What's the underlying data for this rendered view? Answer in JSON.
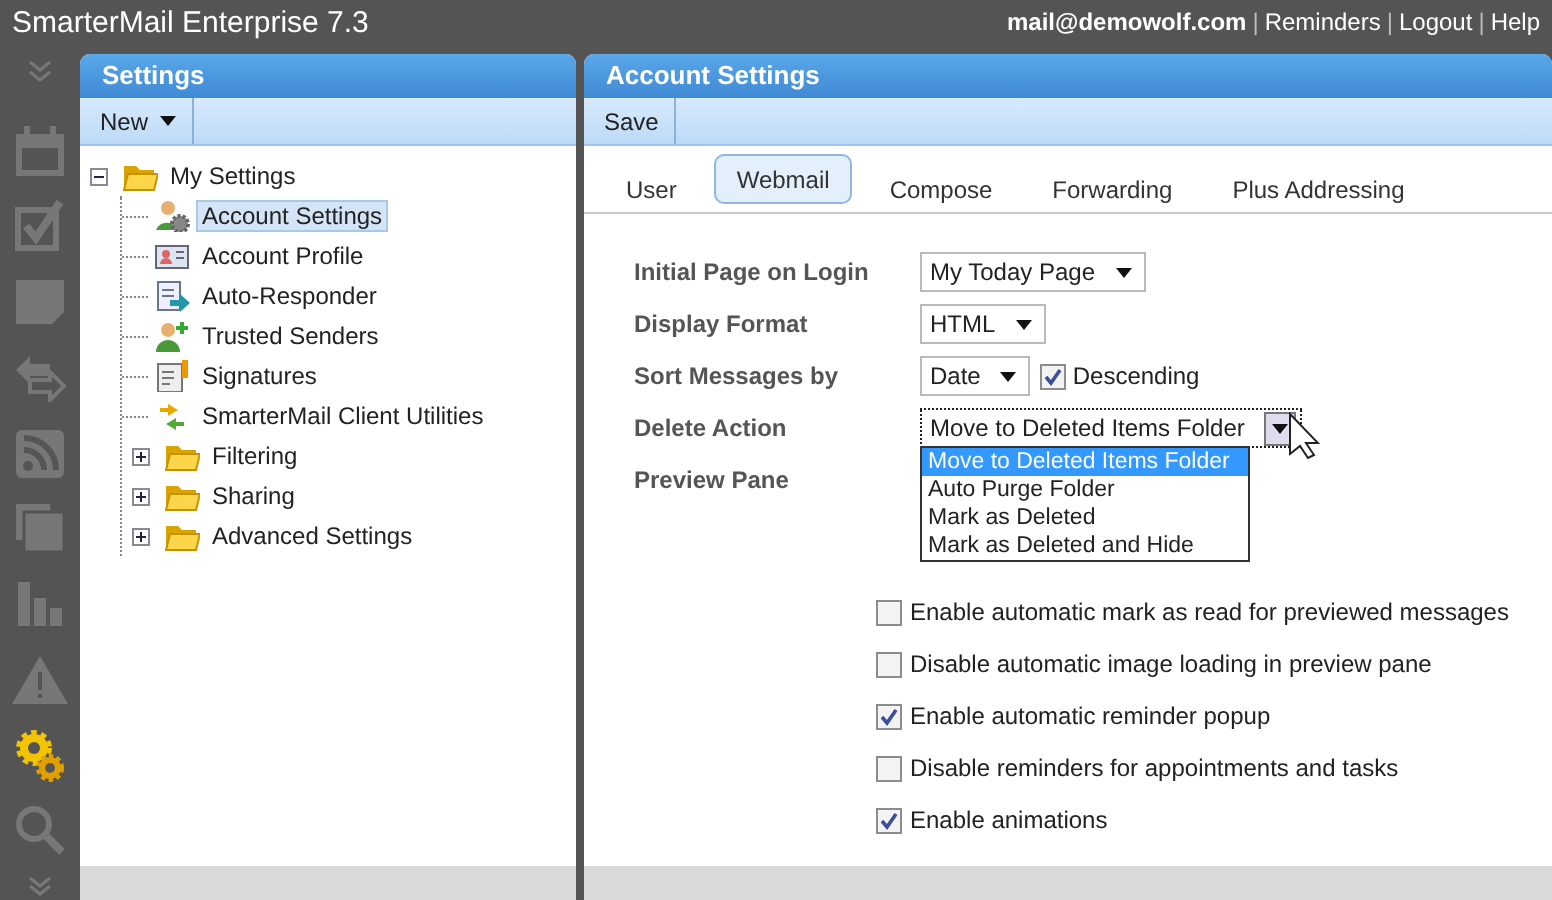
{
  "app_title": "SmarterMail Enterprise 7.3",
  "header": [
    {
      "kind": "user",
      "text": "mail@demowolf.com"
    },
    {
      "kind": "separator",
      "text": "|"
    },
    {
      "kind": "link",
      "text": "Reminders"
    },
    {
      "kind": "separator",
      "text": "|"
    },
    {
      "kind": "link",
      "text": "Logout"
    },
    {
      "kind": "separator",
      "text": "|"
    },
    {
      "kind": "link",
      "text": "Help"
    }
  ],
  "rail": [
    {
      "kind": "collapse",
      "selected": false
    },
    {
      "kind": "calendar",
      "selected": false
    },
    {
      "kind": "tasks",
      "selected": false
    },
    {
      "kind": "notes",
      "selected": false
    },
    {
      "kind": "sync",
      "selected": false
    },
    {
      "kind": "rss",
      "selected": false
    },
    {
      "kind": "files",
      "selected": false
    },
    {
      "kind": "reports",
      "selected": false
    },
    {
      "kind": "alerts",
      "selected": false
    },
    {
      "kind": "settings",
      "selected": true
    },
    {
      "kind": "search",
      "selected": false
    },
    {
      "kind": "expand",
      "selected": false
    }
  ],
  "settings_panel": {
    "title": "Settings",
    "toolbar": [
      {
        "label": "New",
        "dropdown": true
      }
    ],
    "tree": [
      {
        "label": "My Settings",
        "kind": "folder",
        "expanded": true,
        "selected": false,
        "children": [
          {
            "label": "Account Settings",
            "kind": "account",
            "selected": true
          },
          {
            "label": "Account Profile",
            "kind": "profile",
            "selected": false
          },
          {
            "label": "Auto-Responder",
            "kind": "responder",
            "selected": false
          },
          {
            "label": "Trusted Senders",
            "kind": "trusted",
            "selected": false
          },
          {
            "label": "Signatures",
            "kind": "signature",
            "selected": false
          },
          {
            "label": "SmarterMail Client Utilities",
            "kind": "utilities",
            "selected": false
          },
          {
            "label": "Filtering",
            "kind": "folder",
            "expanded": false,
            "selected": false
          },
          {
            "label": "Sharing",
            "kind": "folder",
            "expanded": false,
            "selected": false
          },
          {
            "label": "Advanced Settings",
            "kind": "folder",
            "expanded": false,
            "selected": false
          }
        ]
      }
    ]
  },
  "account_panel": {
    "title": "Account Settings",
    "toolbar": [
      {
        "label": "Save",
        "dropdown": false
      }
    ],
    "tabs": [
      {
        "label": "User",
        "selected": false
      },
      {
        "label": "Webmail",
        "selected": true
      },
      {
        "label": "Compose",
        "selected": false
      },
      {
        "label": "Forwarding",
        "selected": false
      },
      {
        "label": "Plus Addressing",
        "selected": false
      }
    ],
    "fields": [
      {
        "label": "Initial Page on Login",
        "value": "My Today Page"
      },
      {
        "label": "Display Format",
        "value": "HTML"
      },
      {
        "label": "Sort Messages by",
        "value": "Date",
        "checkbox": {
          "label": "Descending",
          "checked": true
        }
      },
      {
        "label": "Delete Action",
        "value": "Move to Deleted Items Folder",
        "open": true,
        "options": [
          {
            "label": "Move to Deleted Items Folder",
            "selected": true
          },
          {
            "label": "Auto Purge Folder",
            "selected": false
          },
          {
            "label": "Mark as Deleted",
            "selected": false
          },
          {
            "label": "Mark as Deleted and Hide",
            "selected": false
          }
        ]
      },
      {
        "label": "Preview Pane"
      }
    ],
    "options": [
      {
        "label": "Enable automatic mark as read for previewed messages",
        "checked": false
      },
      {
        "label": "Disable automatic image loading in preview pane",
        "checked": false
      },
      {
        "label": "Enable automatic reminder popup",
        "checked": true
      },
      {
        "label": "Disable reminders for appointments and tasks",
        "checked": false
      },
      {
        "label": "Enable animations",
        "checked": true
      }
    ]
  }
}
